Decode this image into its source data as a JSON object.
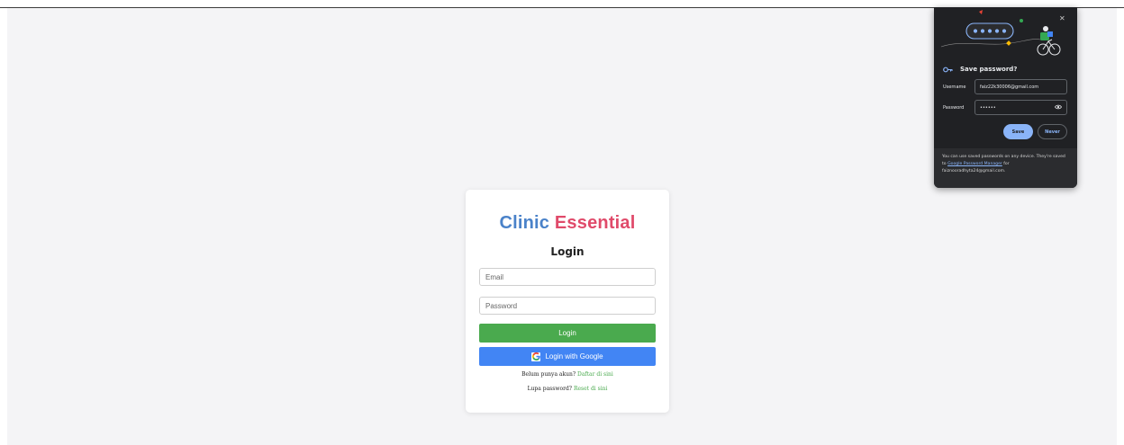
{
  "login_card": {
    "brand_part1": "Clinic",
    "brand_part2": "Essential",
    "title": "Login",
    "email_placeholder": "Email",
    "password_placeholder": "Password",
    "login_button": "Login",
    "google_button": "Login with Google",
    "register_prompt": "Belum punya akun?",
    "register_link": "Daftar di sini",
    "forgot_prompt": "Lupa password?",
    "forgot_link": "Reset di sini"
  },
  "save_password_popup": {
    "title": "Save password?",
    "username_label": "Username",
    "username_value": "faiz22k30006@gmail.com",
    "password_label": "Password",
    "password_value": "••••••",
    "save_button": "Save",
    "never_button": "Never",
    "footer_text_1": "You can use saved passwords on any device. They're saved to",
    "footer_link": "Google Password Manager",
    "footer_text_2": "for",
    "footer_account": "faiznooradhyta24@gmail.com."
  },
  "colors": {
    "brand_blue": "#4a82c9",
    "brand_pink": "#e04a6a",
    "login_green": "#4aaa4e",
    "google_blue": "#4285f4",
    "popup_bg": "#202124",
    "popup_accent": "#8ab4f8"
  },
  "icons": [
    "google-icon",
    "key-icon",
    "close-icon",
    "eye-icon",
    "password-illustration"
  ]
}
